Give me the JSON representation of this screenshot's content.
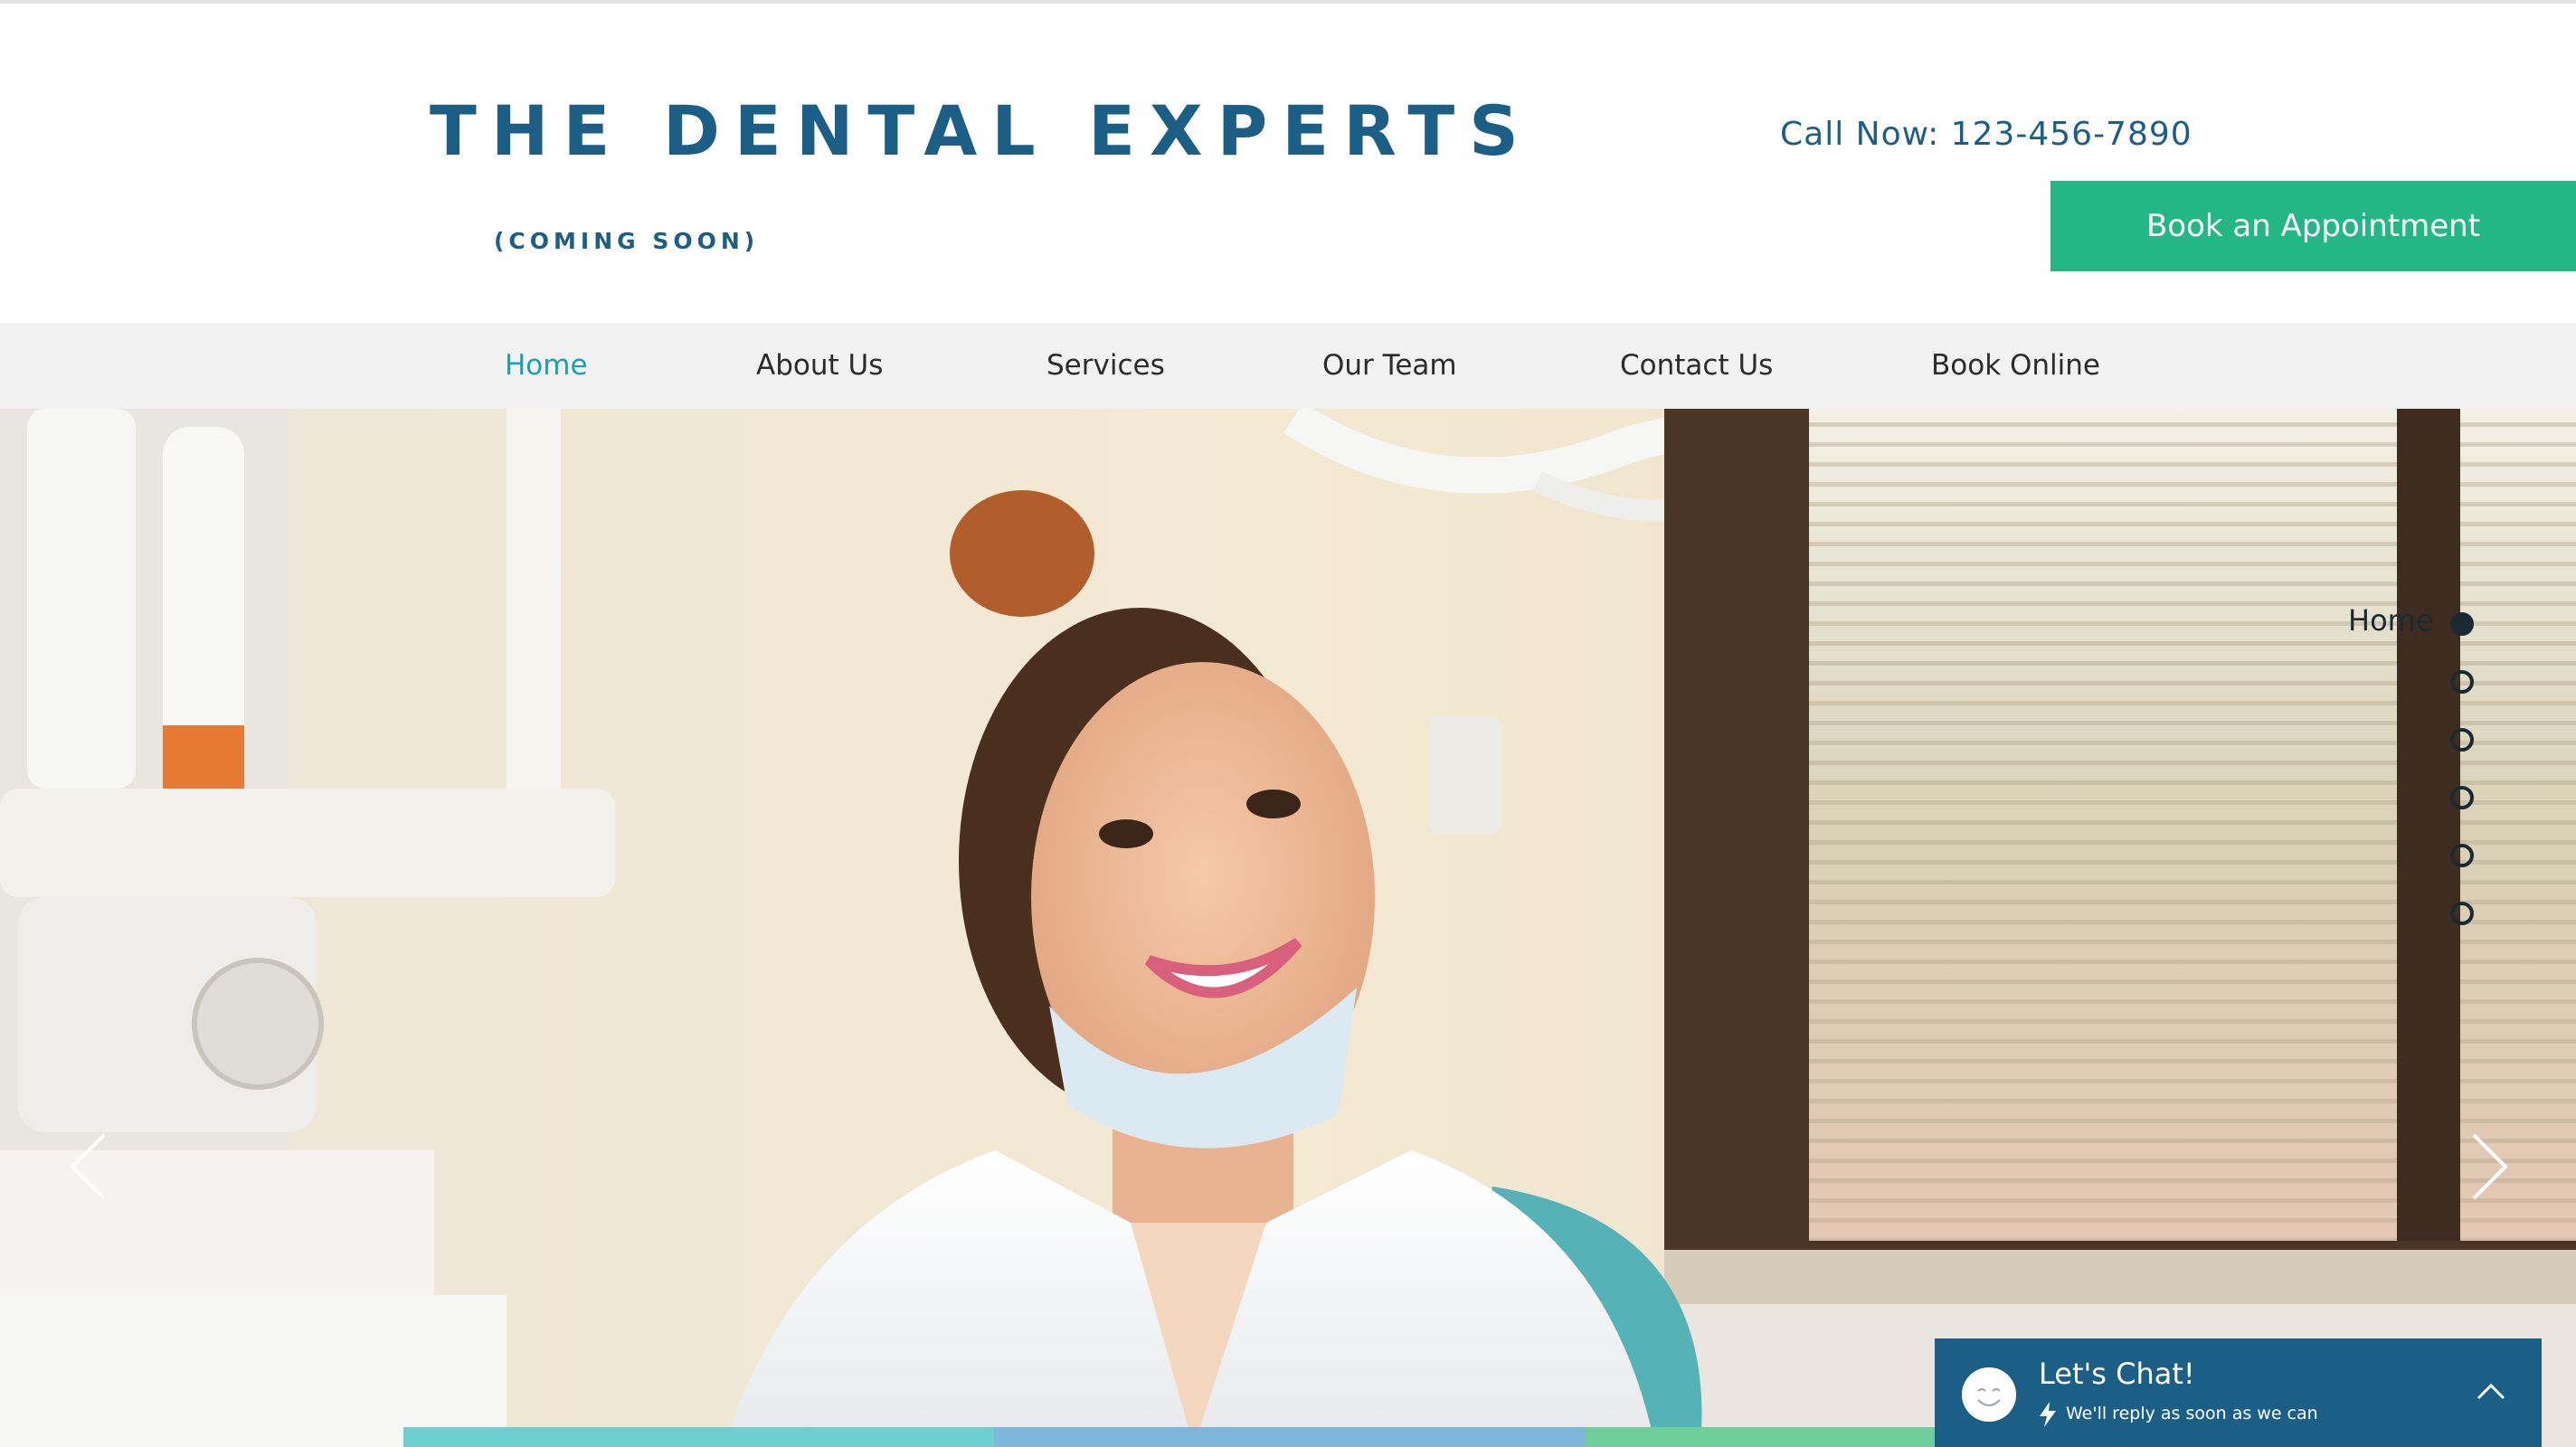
{
  "header": {
    "brand": "THE DENTAL EXPERTS",
    "tagline": "(COMING SOON)",
    "call_now": "Call Now: 123-456-7890",
    "book_button": "Book an Appointment"
  },
  "nav": {
    "items": [
      {
        "label": "Home",
        "active": true
      },
      {
        "label": "About Us"
      },
      {
        "label": "Services"
      },
      {
        "label": "Our Team"
      },
      {
        "label": "Contact Us"
      },
      {
        "label": "Book Online"
      }
    ]
  },
  "hero": {
    "dot_nav_label": "Home",
    "dot_count": 6,
    "active_dot": 1
  },
  "chat": {
    "title": "Let's Chat!",
    "subtitle": "We'll reply as soon as we can"
  },
  "colors": {
    "brand_blue": "#1b5e86",
    "accent_green": "#22b784",
    "nav_active": "#1aa0b0",
    "nav_bg": "#f2f2f2"
  },
  "icons": [
    "chevron-left-icon",
    "chevron-right-icon",
    "smiley-avatar-icon",
    "lightning-bolt-icon",
    "chevron-up-icon"
  ]
}
